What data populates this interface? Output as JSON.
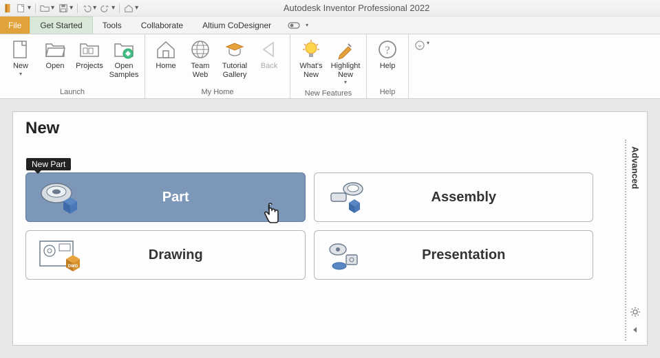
{
  "app": {
    "title": "Autodesk Inventor Professional 2022"
  },
  "tabs": {
    "file": "File",
    "items": [
      "Get Started",
      "Tools",
      "Collaborate",
      "Altium CoDesigner"
    ],
    "active": 0
  },
  "ribbon": {
    "groups": [
      {
        "label": "Launch",
        "buttons": [
          {
            "label": "New",
            "dropdown": true
          },
          {
            "label": "Open"
          },
          {
            "label": "Projects"
          },
          {
            "label": "Open Samples"
          }
        ]
      },
      {
        "label": "My Home",
        "buttons": [
          {
            "label": "Home"
          },
          {
            "label": "Team Web"
          },
          {
            "label": "Tutorial Gallery"
          },
          {
            "label": "Back",
            "disabled": true
          }
        ]
      },
      {
        "label": "New Features",
        "buttons": [
          {
            "label": "What's New"
          },
          {
            "label": "Highlight New",
            "dropdown": true
          }
        ]
      },
      {
        "label": "Help",
        "buttons": [
          {
            "label": "Help"
          }
        ]
      }
    ]
  },
  "panel": {
    "title": "New",
    "tooltip": "New Part",
    "buttons": [
      {
        "label": "Part",
        "selected": true
      },
      {
        "label": "Assembly"
      },
      {
        "label": "Drawing"
      },
      {
        "label": "Presentation"
      }
    ],
    "sidebar_label": "Advanced"
  }
}
